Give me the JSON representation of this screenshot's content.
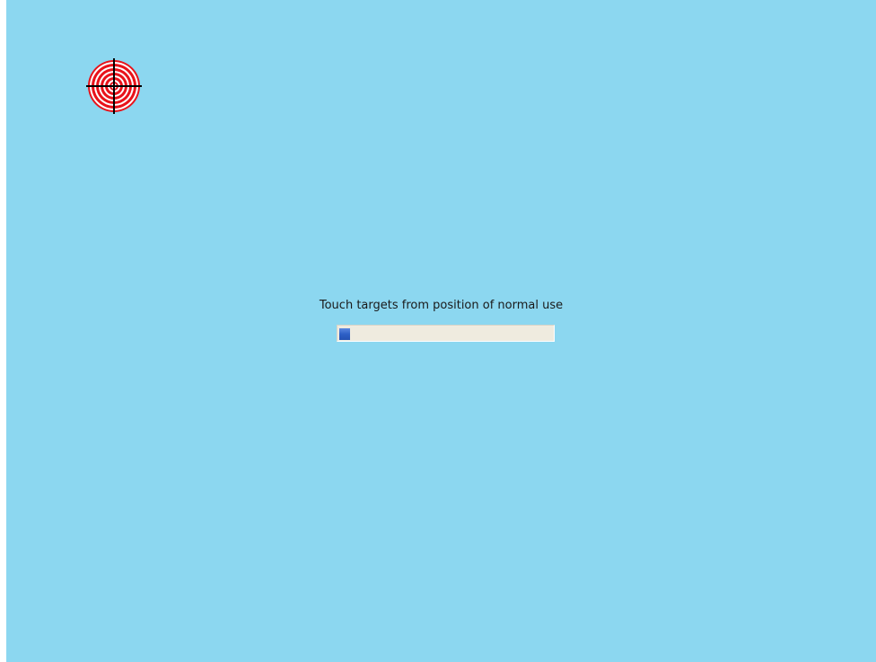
{
  "calibration": {
    "instruction_text": "Touch targets from position of normal use",
    "progress_fraction": 0.05,
    "target_icon": "crosshair-target-icon"
  },
  "colors": {
    "background": "#8cd7f0",
    "target_ring": "#e8121a",
    "crosshair": "#000000",
    "progress_track": "#efebdf",
    "progress_fill": "#2d5fc6"
  }
}
